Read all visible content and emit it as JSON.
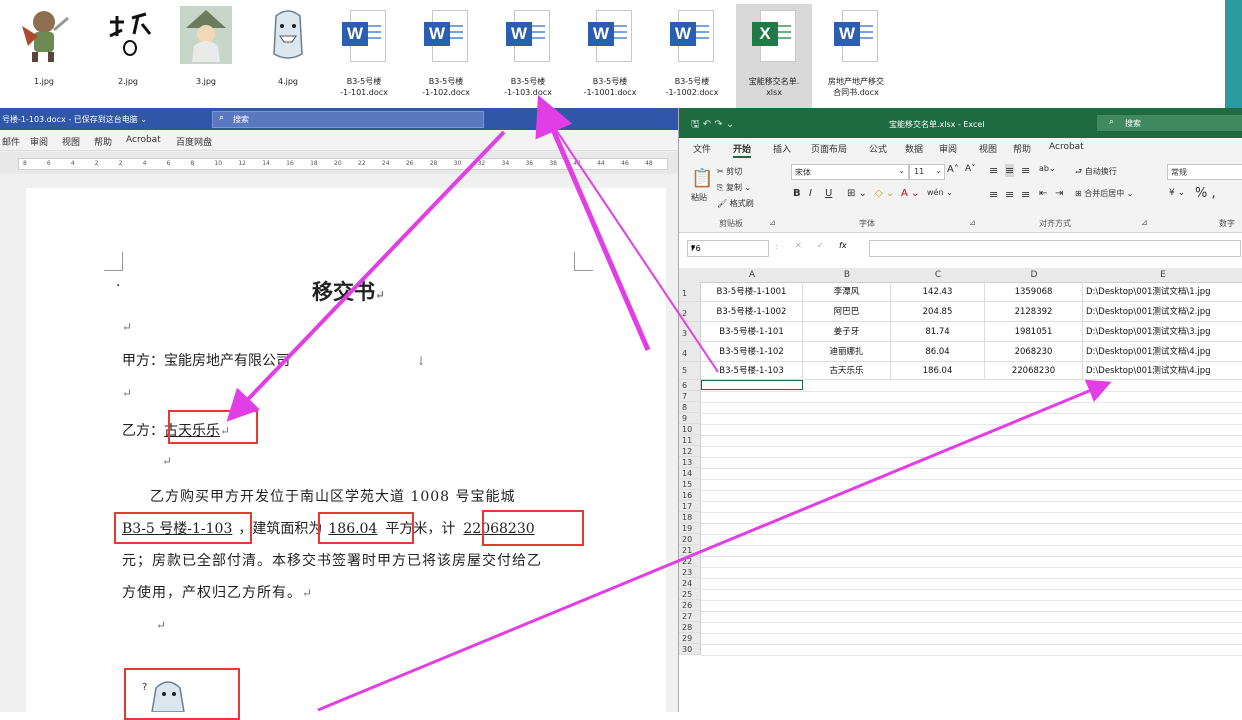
{
  "files": [
    {
      "name": "1.jpg",
      "kind": "image"
    },
    {
      "name": "2.jpg",
      "kind": "image"
    },
    {
      "name": "3.jpg",
      "kind": "image"
    },
    {
      "name": "4.jpg",
      "kind": "image"
    },
    {
      "name": "B3-5号楼\n-1-101.docx",
      "kind": "word"
    },
    {
      "name": "B3-5号楼\n-1-102.docx",
      "kind": "word"
    },
    {
      "name": "B3-5号楼\n-1-103.docx",
      "kind": "word"
    },
    {
      "name": "B3-5号楼\n-1-1001.docx",
      "kind": "word"
    },
    {
      "name": "B3-5号楼\n-1-1002.docx",
      "kind": "word"
    },
    {
      "name": "宝能移交名单.\nxlsx",
      "kind": "excel"
    },
    {
      "name": "房地产地产移交\n合同书.docx",
      "kind": "word"
    }
  ],
  "icons": {
    "word_badge": "W",
    "excel_badge": "X"
  },
  "colors": {
    "word_blue": "#2f56a8",
    "excel_green": "#1e6b42",
    "highlight_red": "#e53935",
    "arrow_magenta": "#e23ee6",
    "accent_teal": "#2a9a9e"
  },
  "word": {
    "title": "号楼-1-103.docx - 已保存到这台电脑 ⌄",
    "search_placeholder": "搜索",
    "menu": [
      "邮件",
      "审阅",
      "视图",
      "帮助",
      "Acrobat",
      "百度网盘"
    ],
    "ruler_ticks": [
      "8",
      "6",
      "4",
      "2",
      "2",
      "4",
      "6",
      "8",
      "10",
      "12",
      "14",
      "16",
      "18",
      "20",
      "22",
      "24",
      "26",
      "28",
      "30",
      "32",
      "34",
      "36",
      "38",
      "42",
      "44",
      "46",
      "48"
    ],
    "doc": {
      "bullet": "·",
      "title": "移交书",
      "return_mark": "↵",
      "line_down_mark": "↓",
      "party_a_label": "甲方：",
      "party_a": "宝能房地产有限公司",
      "party_b_label": "乙方：",
      "party_b": "古天乐乐",
      "para_line1": "乙方购买甲方开发位于南山区学苑大道 1008 号宝能城",
      "building": "B3-5 号楼-1-103",
      "area_prefix": "，建筑面积为",
      "area": "186.04",
      "area_suffix": "平方米，计",
      "amount": "22068230",
      "para_line3": "元；房款已全部付清。本移交书签署时甲方已将该房屋交付给乙",
      "para_line4": "方使用，产权归乙方所有。"
    }
  },
  "excel": {
    "title": "宝能移交名单.xlsx - Excel",
    "search_placeholder": "搜索",
    "tabs": [
      "文件",
      "开始",
      "插入",
      "页面布局",
      "公式",
      "数据",
      "审阅",
      "视图",
      "帮助",
      "Acrobat"
    ],
    "active_tab": "开始",
    "ribbon": {
      "cut": "剪切",
      "copy": "复制 ⌄",
      "format_painter": "格式刷",
      "paste": "粘贴",
      "clipboard_group": "剪贴板",
      "font_name": "宋体",
      "font_size": "11",
      "font_group": "字体",
      "wrap_text": "自动换行",
      "merge_center": "合并后居中 ⌄",
      "align_group": "对齐方式",
      "number_format": "常规",
      "number_group": "数字",
      "bold": "B",
      "italic": "I",
      "underline": "U",
      "grow_font": "A˄",
      "shrink_font": "A˅",
      "percent": "% ,",
      "fill_button": "◇ ⌄",
      "font_color": "A ⌄",
      "phonetic": "wén ⌄",
      "border_button": "⊞ ⌄",
      "align_top": "≡",
      "align_middle": "≡",
      "align_bottom": "≡",
      "orientation": "ab⌄",
      "align_left": "≡",
      "align_center": "≡",
      "align_right": "≡",
      "indent_less": "⇤",
      "indent_more": "⇥",
      "currency": "¥ ⌄",
      "dialog_launcher": "⊿"
    },
    "name_box": "F6",
    "name_box_dropdown": "▾",
    "formula_separator": ":",
    "formula_cancel": "✕",
    "formula_enter": "✓",
    "fx": "fx",
    "columns": [
      "A",
      "B",
      "C",
      "D",
      "E"
    ],
    "rows": [
      [
        "B3-5号楼-1-1001",
        "李潭风",
        "142.43",
        "1359068",
        "D:\\Desktop\\001测试文档\\1.jpg"
      ],
      [
        "B3-5号楼-1-1002",
        "阿巴巴",
        "204.85",
        "2128392",
        "D:\\Desktop\\001测试文档\\2.jpg"
      ],
      [
        "B3-5号楼-1-101",
        "姜子牙",
        "81.74",
        "1981051",
        "D:\\Desktop\\001测试文档\\3.jpg"
      ],
      [
        "B3-5号楼-1-102",
        "迪丽娜扎",
        "86.04",
        "2068230",
        "D:\\Desktop\\001测试文档\\4.jpg"
      ],
      [
        "B3-5号楼-1-103",
        "古天乐乐",
        "186.04",
        "22068230",
        "D:\\Desktop\\001测试文档\\4.jpg"
      ]
    ],
    "row_numbers": [
      "1",
      "2",
      "3",
      "4",
      "5",
      "6",
      "7",
      "8",
      "9",
      "10",
      "11",
      "12",
      "13",
      "14",
      "15",
      "16",
      "17",
      "18",
      "19",
      "20",
      "21",
      "22",
      "23",
      "24",
      "25",
      "26",
      "27",
      "28",
      "29",
      "30"
    ]
  }
}
